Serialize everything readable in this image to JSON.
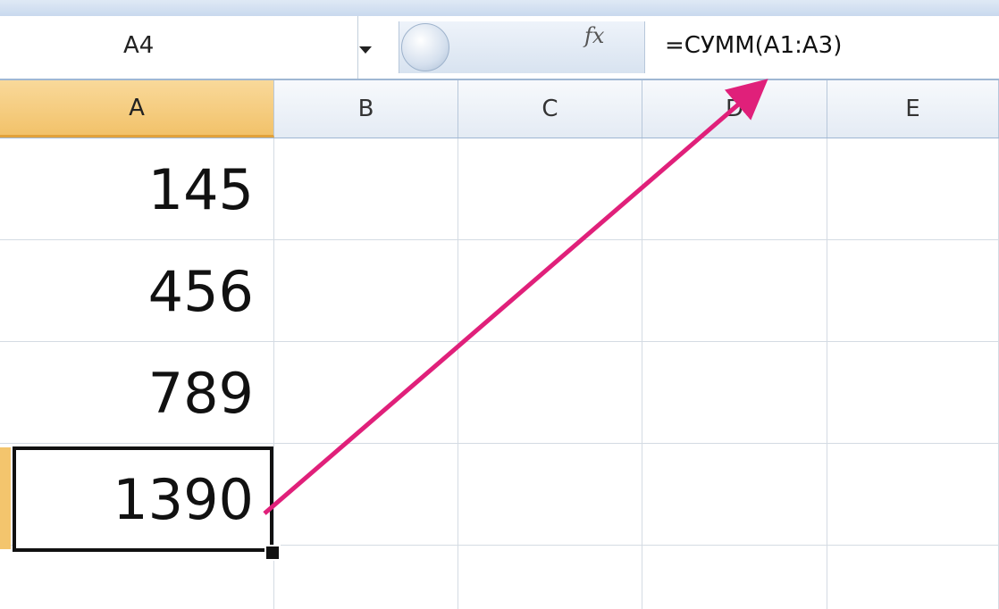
{
  "formula_bar": {
    "name_box": "A4",
    "fx_label": "fx",
    "formula": "=СУММ(A1:A3)"
  },
  "columns": [
    "A",
    "B",
    "C",
    "D",
    "E"
  ],
  "cells": {
    "A1": "145",
    "A2": "456",
    "A3": "789",
    "A4": "1390"
  },
  "icons": {
    "dropdown": "chevron-down-icon",
    "slider": "splitter-knob-icon",
    "fx": "fx-icon"
  },
  "colors": {
    "selected_header": "#f2c26a",
    "arrow": "#e0207a",
    "gridline": "#d4dbe3"
  }
}
